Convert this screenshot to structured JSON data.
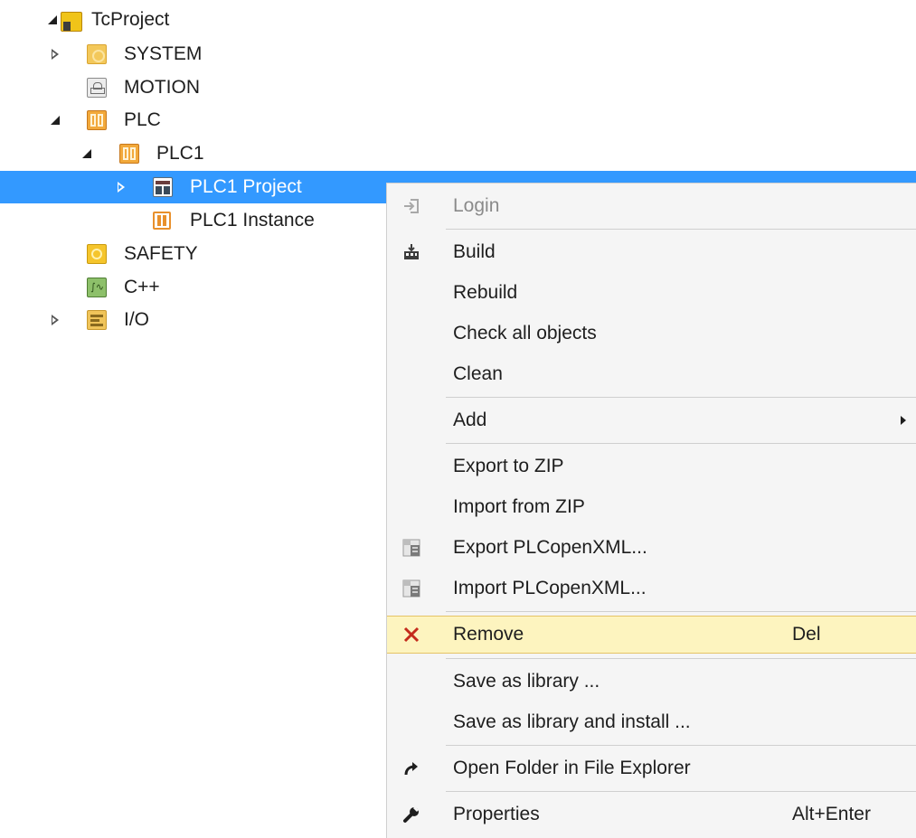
{
  "tree": {
    "nodes": [
      {
        "label": "TcProject",
        "expander": "expanded",
        "icon": "project-icon"
      },
      {
        "label": "SYSTEM",
        "expander": "collapsed",
        "icon": "system-icon"
      },
      {
        "label": "MOTION",
        "expander": "none",
        "icon": "motion-icon"
      },
      {
        "label": "PLC",
        "expander": "expanded",
        "icon": "plc-icon"
      },
      {
        "label": "PLC1",
        "expander": "expanded",
        "icon": "plc-icon"
      },
      {
        "label": "PLC1 Project",
        "expander": "collapsed",
        "icon": "plc-project-icon",
        "selected": true
      },
      {
        "label": "PLC1 Instance",
        "expander": "none",
        "icon": "plc-instance-icon"
      },
      {
        "label": "SAFETY",
        "expander": "none",
        "icon": "safety-icon"
      },
      {
        "label": "C++",
        "expander": "none",
        "icon": "cpp-icon"
      },
      {
        "label": "I/O",
        "expander": "collapsed",
        "icon": "io-icon"
      }
    ]
  },
  "context_menu": {
    "items": [
      {
        "label": "Login",
        "icon": "login-icon",
        "disabled": true
      },
      {
        "label": "Build",
        "icon": "build-icon"
      },
      {
        "label": "Rebuild"
      },
      {
        "label": "Check all objects"
      },
      {
        "label": "Clean"
      },
      {
        "label": "Add",
        "submenu": true
      },
      {
        "label": "Export to ZIP"
      },
      {
        "label": "Import from ZIP"
      },
      {
        "label": "Export PLCopenXML...",
        "icon": "xml-export-icon"
      },
      {
        "label": "Import PLCopenXML...",
        "icon": "xml-import-icon"
      },
      {
        "label": "Remove",
        "icon": "remove-icon",
        "shortcut": "Del",
        "highlighted": true
      },
      {
        "label": "Save as library ..."
      },
      {
        "label": "Save as library and install ..."
      },
      {
        "label": "Open Folder in File Explorer",
        "icon": "open-folder-icon"
      },
      {
        "label": "Properties",
        "icon": "wrench-icon",
        "shortcut": "Alt+Enter"
      }
    ]
  },
  "colors": {
    "selection": "#3399ff",
    "hover": "#fdf4bf",
    "remove_icon": "#c42b1c"
  }
}
